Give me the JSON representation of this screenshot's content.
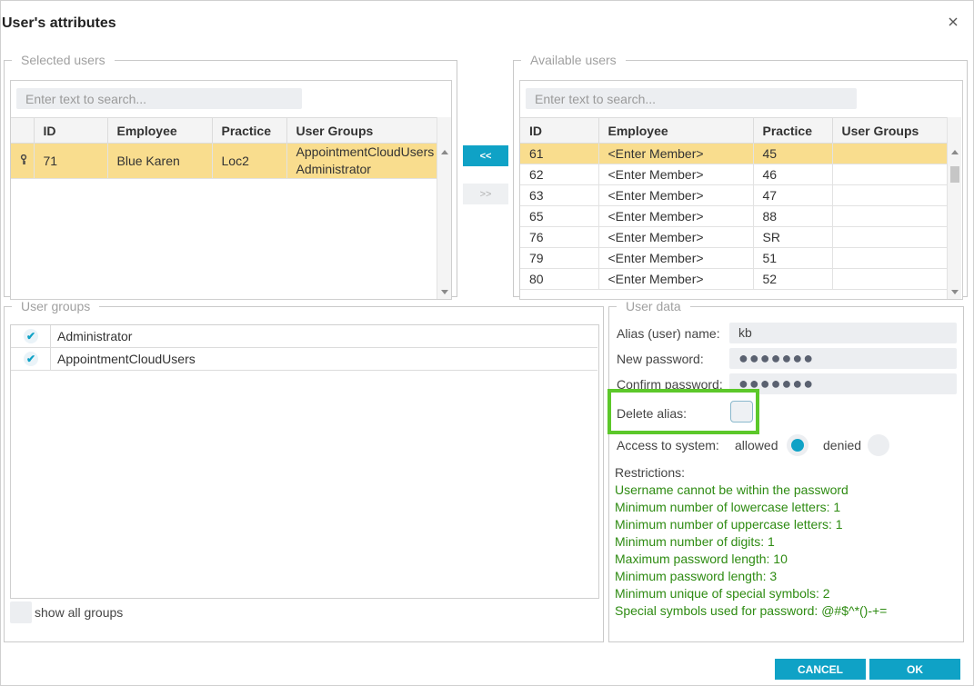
{
  "dialog": {
    "title": "User's attributes",
    "close_icon": "close-icon"
  },
  "selected_users": {
    "legend": "Selected users",
    "search_placeholder": "Enter text to search...",
    "columns": [
      "ID",
      "Employee",
      "Practice",
      "User Groups"
    ],
    "rows": [
      {
        "id": "71",
        "employee": "Blue Karen",
        "practice": "Loc2",
        "groups_line1": "AppointmentCloudUsers",
        "groups_line2": "Administrator",
        "key_icon": "key-icon"
      }
    ]
  },
  "move_buttons": {
    "add_label": "<<",
    "remove_label": ">>"
  },
  "available_users": {
    "legend": "Available users",
    "search_placeholder": "Enter text to search...",
    "columns": [
      "ID",
      "Employee",
      "Practice",
      "User Groups"
    ],
    "rows": [
      {
        "id": "61",
        "employee": "<Enter Member>",
        "practice": "45",
        "groups": ""
      },
      {
        "id": "62",
        "employee": "<Enter Member>",
        "practice": "46",
        "groups": ""
      },
      {
        "id": "63",
        "employee": "<Enter Member>",
        "practice": "47",
        "groups": ""
      },
      {
        "id": "65",
        "employee": "<Enter Member>",
        "practice": "88",
        "groups": ""
      },
      {
        "id": "76",
        "employee": "<Enter Member>",
        "practice": "SR",
        "groups": ""
      },
      {
        "id": "79",
        "employee": "<Enter Member>",
        "practice": "51",
        "groups": ""
      },
      {
        "id": "80",
        "employee": "<Enter Member>",
        "practice": "52",
        "groups": ""
      }
    ]
  },
  "user_groups": {
    "legend": "User groups",
    "items": [
      {
        "label": "Administrator",
        "checked": true
      },
      {
        "label": "AppointmentCloudUsers",
        "checked": true
      }
    ],
    "show_all_label": "show all groups"
  },
  "user_data": {
    "legend": "User data",
    "alias_label": "Alias (user) name:",
    "alias_value": "kb",
    "new_password_label": "New password:",
    "new_password_value": "●●●●●●●",
    "confirm_password_label": "Confirm password:",
    "confirm_password_value": "●●●●●●●",
    "delete_alias_label": "Delete alias:",
    "access_label": "Access to system:",
    "allowed_label": "allowed",
    "denied_label": "denied",
    "access_value": "allowed",
    "highlight_color": "#5cc82a",
    "restrictions_label": "Restrictions:",
    "restrictions": [
      "Username cannot be within the password",
      "Minimum number of lowercase letters: 1",
      "Minimum number of uppercase letters: 1",
      "Minimum number of digits: 1",
      "Maximum password length: 10",
      "Minimum password length: 3",
      "Minimum unique of special symbols: 2",
      "Special symbols used for password: @#$^*()-+="
    ]
  },
  "footer": {
    "cancel_label": "CANCEL",
    "ok_label": "OK"
  },
  "colors": {
    "accent": "#0fa2c6",
    "selected_row": "#f9dd8e",
    "restriction_text": "#2e8b12"
  }
}
